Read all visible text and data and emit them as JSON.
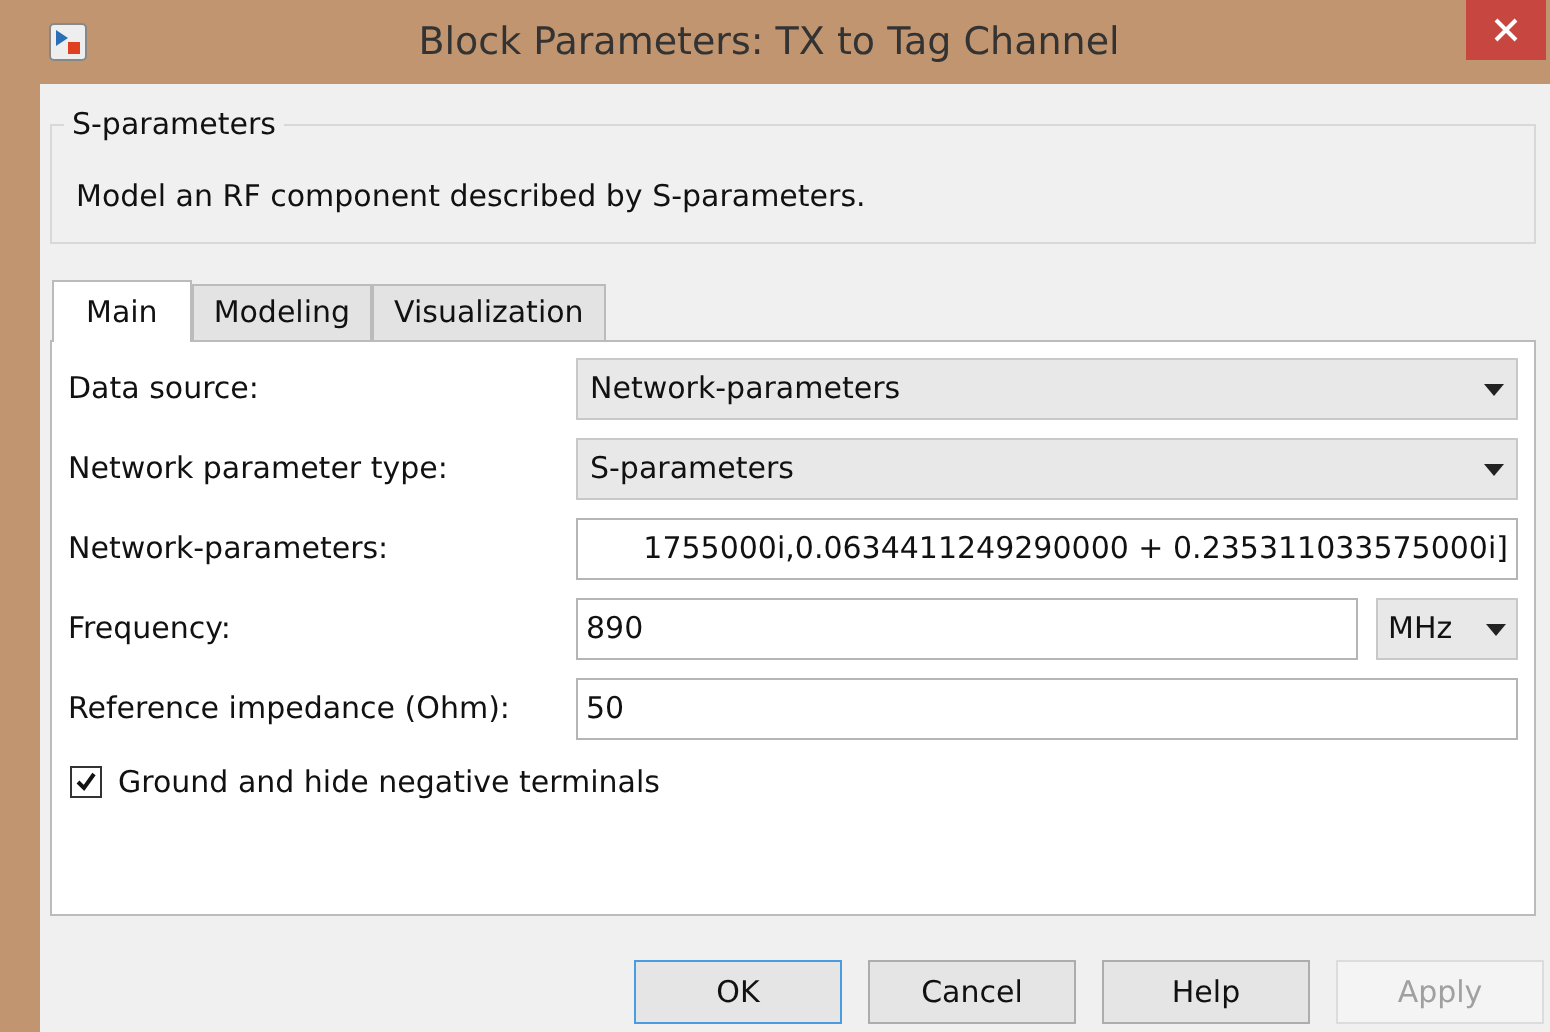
{
  "window": {
    "title": "Block Parameters: TX to Tag Channel"
  },
  "group": {
    "title": "S-parameters",
    "description": "Model an RF component described by S-parameters."
  },
  "tabs": [
    {
      "label": "Main",
      "selected": true
    },
    {
      "label": "Modeling",
      "selected": false
    },
    {
      "label": "Visualization",
      "selected": false
    }
  ],
  "fields": [
    {
      "kind": "dropdown",
      "label": "Data source:",
      "value": "Network-parameters"
    },
    {
      "kind": "dropdown",
      "label": "Network parameter type:",
      "value": "S-parameters"
    },
    {
      "kind": "text",
      "label": "Network-parameters:",
      "value": "1755000i,0.0634411249290000 + 0.235311033575000i]"
    },
    {
      "kind": "unit",
      "label": "Frequency:",
      "value": "890",
      "unit": "MHz"
    },
    {
      "kind": "text",
      "label": "Reference impedance (Ohm):",
      "value": "50"
    }
  ],
  "checkbox": {
    "label": "Ground and hide negative terminals",
    "checked": true
  },
  "buttons": [
    {
      "label": "OK",
      "default": true,
      "disabled": false
    },
    {
      "label": "Cancel",
      "default": false,
      "disabled": false
    },
    {
      "label": "Help",
      "default": false,
      "disabled": false
    },
    {
      "label": "Apply",
      "default": false,
      "disabled": true
    }
  ]
}
